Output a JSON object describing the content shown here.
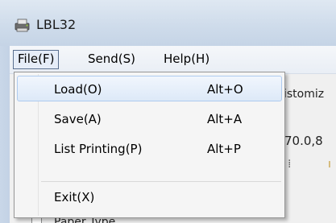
{
  "window": {
    "title": "LBL32",
    "icon": "printer-app-icon"
  },
  "menubar": {
    "items": [
      {
        "label": "File(F)",
        "active": true
      },
      {
        "label": "Send(S)",
        "active": false
      },
      {
        "label": "Help(H)",
        "active": false
      }
    ]
  },
  "file_menu": {
    "items": [
      {
        "label": "Load(O)",
        "shortcut": "Alt+O",
        "highlighted": true
      },
      {
        "label": "Save(A)",
        "shortcut": "Alt+A",
        "highlighted": false
      },
      {
        "label": "List Printing(P)",
        "shortcut": "Alt+P",
        "highlighted": false
      },
      {
        "label": "Exit(X)",
        "shortcut": "",
        "highlighted": false
      }
    ]
  },
  "background": {
    "customize_fragment": "istomiz",
    "value_fragment": "70.0,8",
    "paper_type_label": "Paper Type"
  },
  "colors": {
    "titlebar": "#cfdceb",
    "menu_hover_border": "#aecbef",
    "menu_active_border": "#5a6f8f"
  }
}
